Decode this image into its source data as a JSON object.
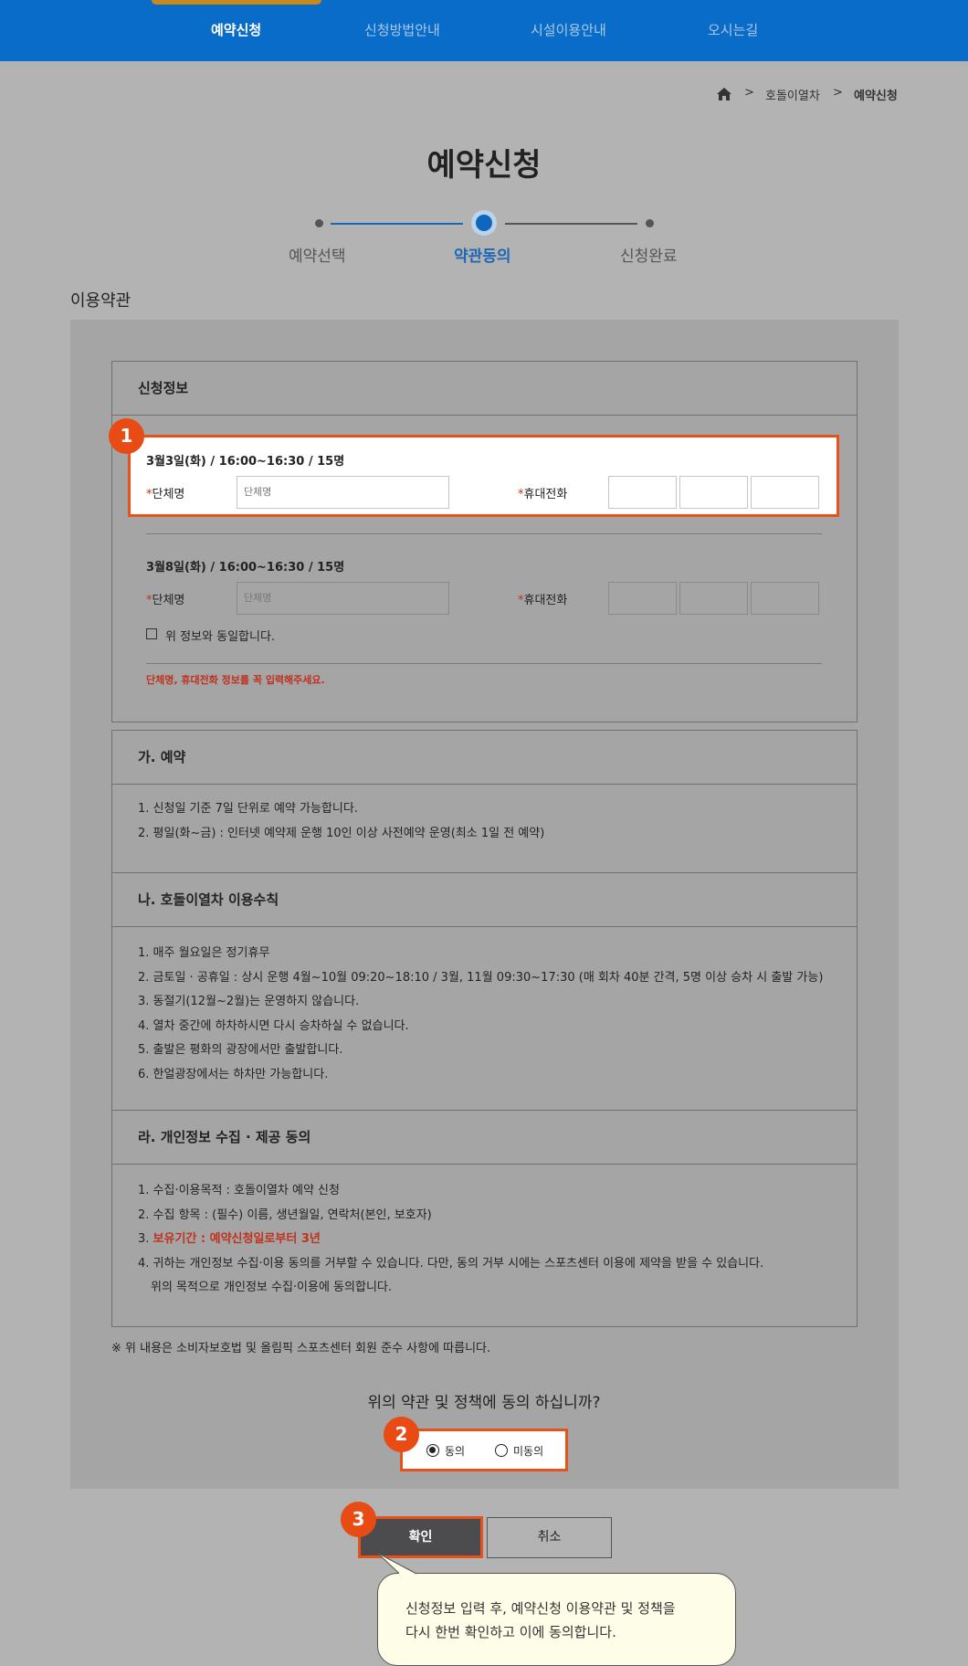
{
  "nav": {
    "items": [
      "예약신청",
      "신청방법안내",
      "시설이용안내",
      "오시는길"
    ]
  },
  "breadcrumb": {
    "items": [
      "호돌이열차",
      "예약신청"
    ]
  },
  "page_title": "예약신청",
  "steps": [
    "예약선택",
    "약관동의",
    "신청완료"
  ],
  "section_title": "이용약관",
  "application": {
    "header": "신청정보",
    "entry1": {
      "title": "3월3일(화) / 16:00~16:30 / 15명",
      "group_label": "단체명",
      "group_placeholder": "단체명",
      "phone_label": "휴대전화"
    },
    "entry2": {
      "title": "3월8일(화) / 16:00~16:30 / 15명",
      "group_label": "단체명",
      "group_placeholder": "단체명",
      "phone_label": "휴대전화"
    },
    "same_info_label": "위 정보와 동일합니다.",
    "warning": "단체명, 휴대전화 정보를 꼭 입력해주세요."
  },
  "terms": {
    "reservation": {
      "title": "가. 예약",
      "lines": [
        "1. 신청일 기준 7일 단위로 예약 가능합니다.",
        "2. 평일(화~금) : 인터넷 예약제 운행 10인 이상 사전예약 운영(최소 1일 전 예약)"
      ]
    },
    "rules": {
      "title": "나. 호돌이열차 이용수칙",
      "lines": [
        "1. 매주 월요일은 정기휴무",
        "2. 금토일 · 공휴일 : 상시 운행 4월~10월 09:20~18:10 / 3월, 11월 09:30~17:30 (매 회차 40분 간격, 5명 이상 승차 시 출발 가능)",
        "3. 동절기(12월~2월)는 운영하지 않습니다.",
        "4. 열차 중간에 하차하시면 다시 승차하실 수 없습니다.",
        "5. 출발은 평화의 광장에서만 출발합니다.",
        "6. 한얼광장에서는 하차만 가능합니다."
      ]
    },
    "privacy": {
      "title": "라. 개인정보 수집 · 제공 동의",
      "line1": "1. 수집·이용목적 : 호돌이열차 예약 신청",
      "line2": "2. 수집 항목 : (필수) 이름, 생년월일, 연락처(본인, 보호자)",
      "line3_prefix": "3. ",
      "line3_highlight": "보유기간 : 예약신청일로부터 3년",
      "line4": "4. 귀하는 개인정보 수집·이용 동의를 거부할 수 있습니다. 다만, 동의 거부 시에는 스포츠센터 이용에 제약을 받을 수 있습니다.",
      "line5": "위의 목적으로 개인정보 수집·이용에 동의합니다."
    },
    "footnote": "※ 위 내용은 소비자보호법 및 올림픽 스포츠센터 회원 준수 사항에 따릅니다."
  },
  "consent": {
    "question": "위의 약관 및 정책에 동의 하십니까?",
    "agree_label": "동의",
    "disagree_label": "미동의",
    "selected": "동의"
  },
  "buttons": {
    "confirm": "확인",
    "cancel": "취소"
  },
  "badges": [
    "1",
    "2",
    "3"
  ],
  "tooltip": {
    "line1": "신청정보 입력 후, 예약신청 이용약관 및 정책을",
    "line2": "다시 한번 확인하고 이에 동의합니다."
  },
  "colors": {
    "nav_bg": "#0a6cc9",
    "highlight": "#e5531b",
    "active_step": "#1d67b7",
    "warning_text": "#c0311e"
  }
}
